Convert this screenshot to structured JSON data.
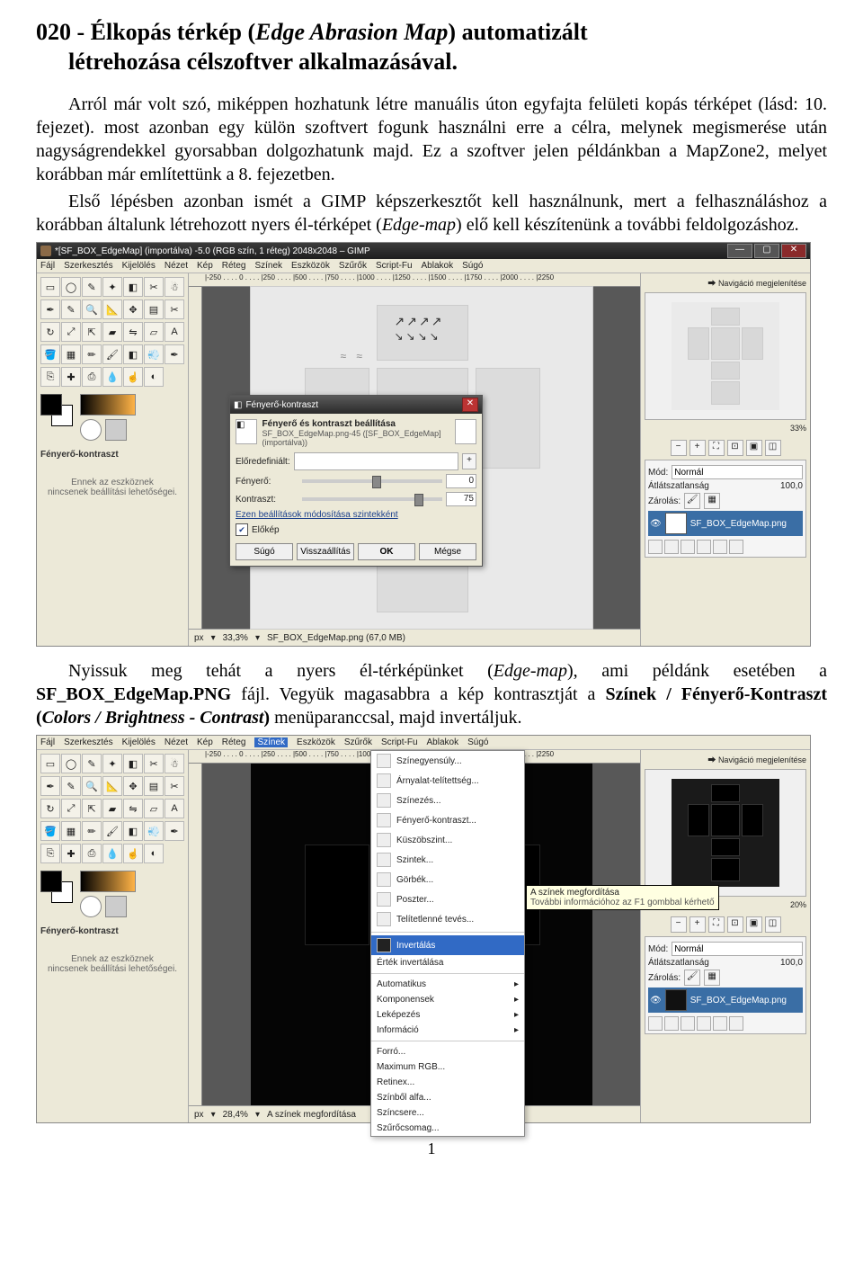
{
  "heading": {
    "pre": "020 - Élkopás térkép (",
    "italic": "Edge Abrasion Map",
    "post": ") automatizált",
    "line2": "létrehozása célszoftver alkalmazásával."
  },
  "para1": "Arról már volt szó, miképpen hozhatunk létre manuális úton egyfajta felületi kopás térképet (lásd: 10. fejezet). most azonban egy külön szoftvert fogunk használni erre a célra, melynek megismerése után nagyságrendekkel gyorsabban dolgozhatunk majd. Ez a szoftver jelen példánkban a MapZone2, melyet korábban már említettünk a 8. fejezetben.",
  "para2_a": "Első lépésben azonban ismét a GIMP képszerkesztőt kell használnunk, mert a felhasználáshoz a korábban általunk létrehozott nyers él-térképet (",
  "para2_i": "Edge-map",
  "para2_b": ") elő kell készítenünk a további feldolgozáshoz.",
  "para3_a": "Nyissuk meg tehát a nyers él-térképünket (",
  "para3_i1": "Edge-map",
  "para3_b": "), ami példánk esetében a ",
  "para3_bold1": "SF_BOX_EdgeMap.PNG",
  "para3_c": " fájl. Vegyük magasabbra a kép kontrasztját a ",
  "para3_bold2": "Színek / Fényerő-Kontraszt (",
  "para3_i2": "Colors / Brightness - Contrast",
  "para3_bold3": ")",
  "para3_d": " menüparanccsal, majd invertáljuk.",
  "gimp": {
    "title": "*[SF_BOX_EdgeMap] (importálva) -5.0 (RGB szín, 1 réteg) 2048x2048 – GIMP",
    "menus": [
      "Fájl",
      "Szerkesztés",
      "Kijelölés",
      "Nézet",
      "Kép",
      "Réteg",
      "Színek",
      "Eszközök",
      "Szűrők",
      "Script-Fu",
      "Ablakok",
      "Súgó"
    ],
    "ruler_ticks": "|-250 . . . . 0 . . . . |250 . . . . |500 . . . . |750 . . . . |1000 . . . . |1250 . . . . |1500 . . . . |1750 . . . . |2000 . . . . |2250",
    "statusbar_unit": "px",
    "statusbar_zoom": "33,3%",
    "statusbar_file": "SF_BOX_EdgeMap.png (67,0 MB)",
    "nav_label": "Navigáció megjelenítése",
    "nav_zoom_pct": "33%",
    "mode_label": "Mód:",
    "mode_value": "Normál",
    "opacity_label": "Átlátszatlanság",
    "opacity_value": "100,0",
    "lock_label": "Zárolás:",
    "layer_name": "SF_BOX_EdgeMap.png",
    "tool_options_title": "Fényerő-kontraszt",
    "tool_options_msg_l1": "Ennek az eszköznek",
    "tool_options_msg_l2": "nincsenek beállítási lehetőségei."
  },
  "dialog": {
    "title": "Fényerő-kontraszt",
    "head": "Fényerő és kontraszt beállítása",
    "subhead": "SF_BOX_EdgeMap.png-45 ([SF_BOX_EdgeMap] (importálva))",
    "preset_label": "Előredefiniált:",
    "brightness_label": "Fényerő:",
    "brightness_value": "0",
    "contrast_label": "Kontraszt:",
    "contrast_value": "75",
    "link": "Ezen beállítások módosítása szintekként",
    "preview": "Előkép",
    "btn_help": "Súgó",
    "btn_reset": "Visszaállítás",
    "btn_ok": "OK",
    "btn_cancel": "Mégse"
  },
  "gimp2": {
    "statusbar_zoom": "28,4%",
    "statusbar_hint": "A színek megfordítása",
    "nav_zoom_pct": "20%",
    "tooltip_line1": "A színek megfordítása",
    "tooltip_line2": "További információhoz az F1 gombbal kérhető"
  },
  "colors_menu": {
    "items": [
      "Színegyensúly...",
      "Árnyalat-telítettség...",
      "Színezés...",
      "Fényerő-kontraszt...",
      "Küszöbszint...",
      "Szintek...",
      "Görbék...",
      "Poszter...",
      "Telítetlenné tevés..."
    ],
    "invert": "Invertálás",
    "value_invert": "Érték invertálása",
    "groups": [
      "Automatikus",
      "Komponensek",
      "Leképezés",
      "Információ"
    ],
    "tail": [
      "Forró...",
      "Maximum RGB...",
      "Retinex...",
      "Színből alfa...",
      "Színcsere...",
      "Szűrőcsomag..."
    ]
  },
  "pagenum": "1"
}
